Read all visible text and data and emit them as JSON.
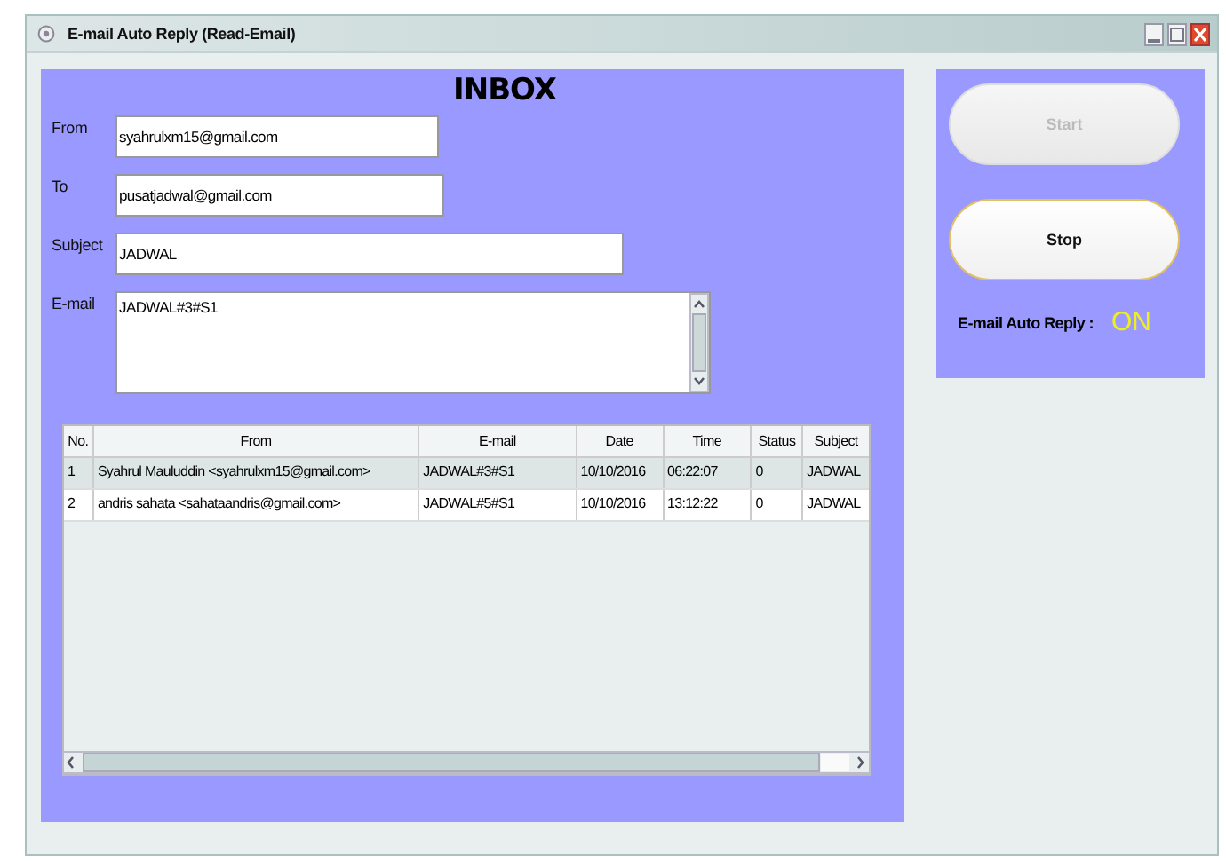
{
  "window": {
    "title": "E-mail Auto Reply (Read-Email)"
  },
  "inbox": {
    "title": "INBOX",
    "fields": [
      {
        "kind": "line",
        "label": "From",
        "value": "syahrulxm15@gmail.com"
      },
      {
        "kind": "line",
        "label": "To",
        "value": "pusatjadwal@gmail.com"
      },
      {
        "kind": "wide",
        "label": "Subject",
        "value": "JADWAL"
      },
      {
        "kind": "area",
        "label": "E-mail",
        "value": "JADWAL#3#S1"
      }
    ],
    "table": {
      "columns": [
        "No.",
        "From",
        "E-mail",
        "Date",
        "Time",
        "Status",
        "Subject"
      ],
      "rows": [
        {
          "selected": true,
          "cells": [
            "1",
            "Syahrul Mauluddin <syahrulxm15@gmail.com>",
            "JADWAL#3#S1",
            "10/10/2016",
            "06:22:07",
            "0",
            "JADWAL"
          ]
        },
        {
          "selected": false,
          "cells": [
            "2",
            "andris sahata <sahataandris@gmail.com>",
            "JADWAL#5#S1",
            "10/10/2016",
            "13:12:22",
            "0",
            "JADWAL"
          ]
        }
      ]
    }
  },
  "controls": {
    "buttons": [
      {
        "label": "Start",
        "disabled": true
      },
      {
        "label": "Stop",
        "disabled": false
      }
    ],
    "status_label": "E-mail Auto Reply :",
    "status_value": "ON",
    "status_on": true
  }
}
